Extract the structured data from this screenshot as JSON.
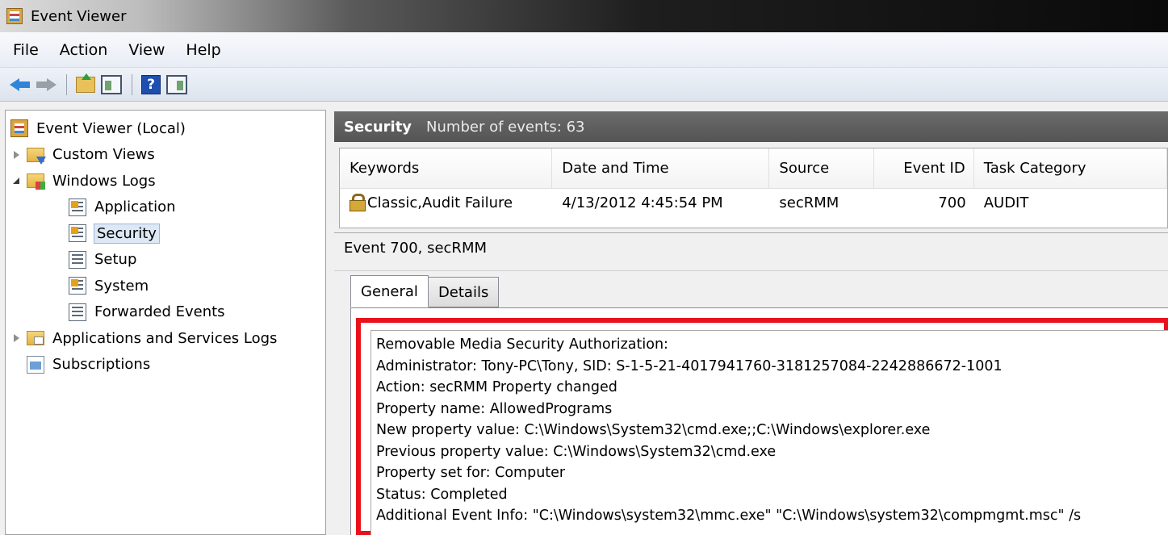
{
  "window": {
    "title": "Event Viewer"
  },
  "menu": [
    "File",
    "Action",
    "View",
    "Help"
  ],
  "toolbar": {
    "buttons": [
      "back-arrow-icon",
      "forward-arrow-icon",
      "folder-up-icon",
      "show-hide-console-tree-icon",
      "help-icon",
      "show-hide-action-pane-icon"
    ],
    "help_glyph": "?"
  },
  "tree": {
    "root": "Event Viewer (Local)",
    "custom_views": "Custom Views",
    "windows_logs": "Windows Logs",
    "logs": [
      "Application",
      "Security",
      "Setup",
      "System",
      "Forwarded Events"
    ],
    "apps_services": "Applications and Services Logs",
    "subscriptions": "Subscriptions",
    "selected": "Security"
  },
  "header": {
    "log_name": "Security",
    "count_text": "Number of events: 63"
  },
  "events": {
    "columns": [
      "Keywords",
      "Date and Time",
      "Source",
      "Event ID",
      "Task Category"
    ],
    "rows": [
      {
        "keywords": "Classic,Audit Failure",
        "datetime": "4/13/2012 4:45:54 PM",
        "source": "secRMM",
        "event_id": "700",
        "task_category": "AUDIT"
      }
    ]
  },
  "detail": {
    "title": "Event 700, secRMM",
    "tabs": [
      "General",
      "Details"
    ],
    "active_tab": "General",
    "lines": [
      "Removable Media Security Authorization:",
      "Administrator: Tony-PC\\Tony, SID: S-1-5-21-4017941760-3181257084-2242886672-1001",
      "Action: secRMM Property changed",
      "Property name: AllowedPrograms",
      "New property value: C:\\Windows\\System32\\cmd.exe;;C:\\Windows\\explorer.exe",
      "Previous property value: C:\\Windows\\System32\\cmd.exe",
      "Property set for: Computer",
      "Status: Completed",
      "Additional Event Info: \"C:\\Windows\\system32\\mmc.exe\" \"C:\\Windows\\system32\\compmgmt.msc\" /s"
    ],
    "highlight_color": "#e8111c"
  }
}
